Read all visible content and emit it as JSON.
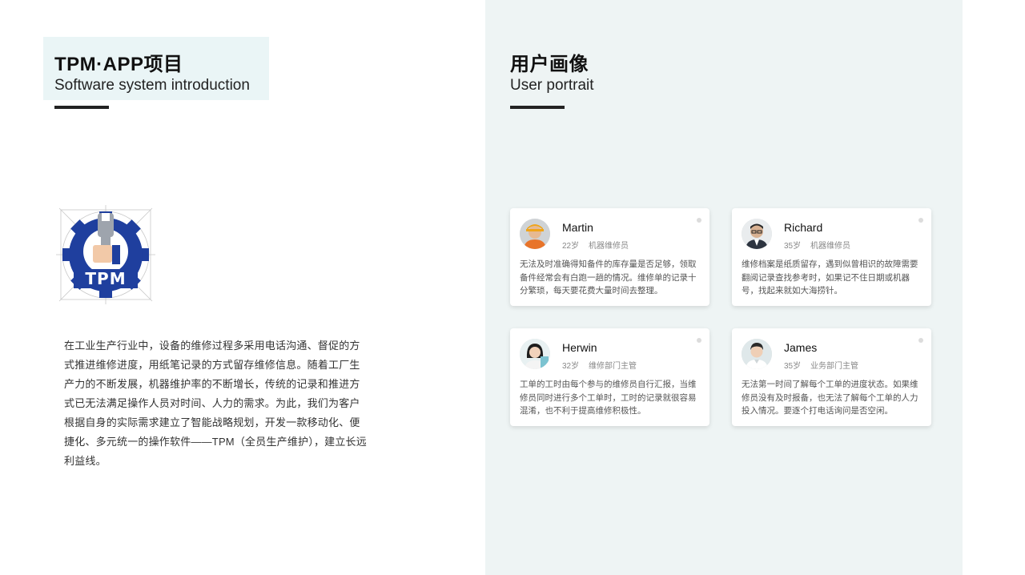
{
  "left": {
    "title_cn": "TPM·APP项目",
    "title_en": "Software system introduction",
    "intro": "在工业生产行业中，设备的维修过程多采用电话沟通、督促的方式推进维修进度，用纸笔记录的方式留存维修信息。随着工厂生产力的不断发展，机器维护率的不断增长，传统的记录和推进方式已无法满足操作人员对时间、人力的需求。为此，我们为客户根据自身的实际需求建立了智能战略规划，开发一款移动化、便捷化、多元统一的操作软件——TPM（全员生产维护），建立长远利益线。",
    "logo_text": "TPM"
  },
  "right": {
    "title_cn": "用户画像",
    "title_en": "User portrait"
  },
  "personas": [
    {
      "name": "Martin",
      "age": "22岁",
      "role": "机器维修员",
      "desc": "无法及时准确得知备件的库存量是否足够，领取备件经常会有白跑一趟的情况。维修单的记录十分繁琐，每天要花费大量时间去整理。",
      "avatar_icon": "worker-avatar-icon"
    },
    {
      "name": "Richard",
      "age": "35岁",
      "role": "机器维修员",
      "desc": "维修档案是纸质留存，遇到似曾相识的故障需要翻阅记录查找参考时，如果记不住日期或机器号，找起来就如大海捞针。",
      "avatar_icon": "man-glasses-avatar-icon"
    },
    {
      "name": "Herwin",
      "age": "32岁",
      "role": "维修部门主管",
      "desc": "工单的工时由每个参与的维修员自行汇报，当维修员同时进行多个工单时，工时的记录就很容易混淆，也不利于提高维修积极性。",
      "avatar_icon": "woman-avatar-icon"
    },
    {
      "name": "James",
      "age": "35岁",
      "role": "业务部门主管",
      "desc": "无法第一时间了解每个工单的进度状态。如果维修员没有及时报备，也无法了解每个工单的人力投入情况。要逐个打电话询问是否空闲。",
      "avatar_icon": "man-avatar-icon"
    }
  ],
  "colors": {
    "panel_bg": "#eef4f4",
    "title_box_bg": "#eaf5f6",
    "logo_blue": "#1f3f9e",
    "accent_bar": "#222222"
  }
}
